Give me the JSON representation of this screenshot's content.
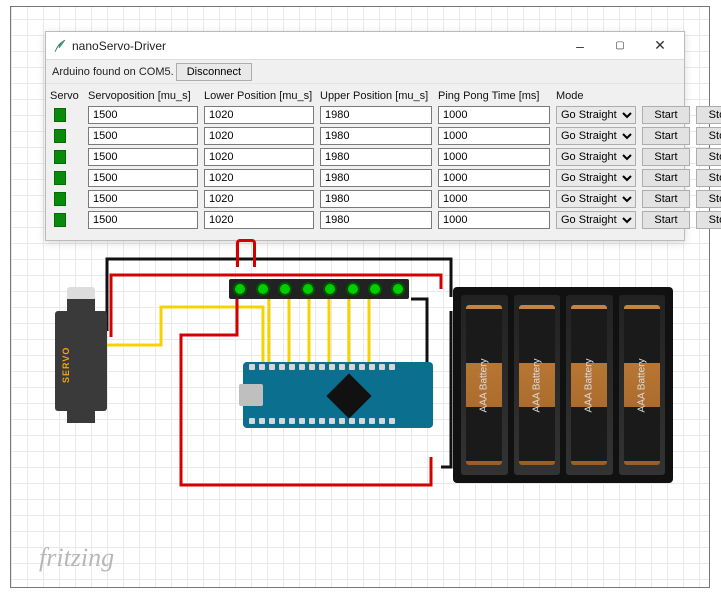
{
  "window": {
    "title": "nanoServo-Driver",
    "status": "Arduino found on COM5.",
    "disconnect_label": "Disconnect",
    "win_buttons": {
      "min": "minimize",
      "max": "maximize",
      "close": "close"
    }
  },
  "columns": {
    "servo": "Servo",
    "servopos": "Servoposition [mu_s]",
    "lower": "Lower Position [mu_s]",
    "upper": "Upper Position [mu_s]",
    "ping": "Ping Pong Time [ms]",
    "mode": "Mode"
  },
  "buttons": {
    "start": "Start",
    "stop": "Stop"
  },
  "mode_option": "Go Straight",
  "rows": [
    {
      "servopos": "1500",
      "lower": "1020",
      "upper": "1980",
      "ping": "1000",
      "mode": "Go Straight"
    },
    {
      "servopos": "1500",
      "lower": "1020",
      "upper": "1980",
      "ping": "1000",
      "mode": "Go Straight"
    },
    {
      "servopos": "1500",
      "lower": "1020",
      "upper": "1980",
      "ping": "1000",
      "mode": "Go Straight"
    },
    {
      "servopos": "1500",
      "lower": "1020",
      "upper": "1980",
      "ping": "1000",
      "mode": "Go Straight"
    },
    {
      "servopos": "1500",
      "lower": "1020",
      "upper": "1980",
      "ping": "1000",
      "mode": "Go Straight"
    },
    {
      "servopos": "1500",
      "lower": "1020",
      "upper": "1980",
      "ping": "1000",
      "mode": "Go Straight"
    }
  ],
  "circuit": {
    "servo_label": "SERVO",
    "battery_label": "AAA Battery",
    "branding": "fritzing"
  }
}
